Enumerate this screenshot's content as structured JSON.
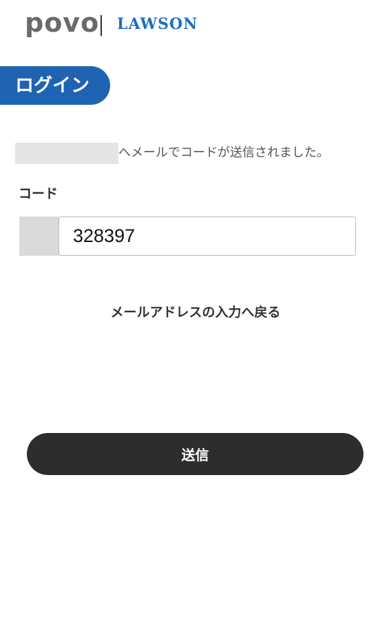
{
  "header": {
    "brand_primary": "povo",
    "brand_partner": "LAWSON"
  },
  "page": {
    "title": "ログイン"
  },
  "verification": {
    "sent_message": "へメールでコードが送信されました。"
  },
  "code_field": {
    "label": "コード",
    "value": "328397"
  },
  "links": {
    "back_to_email": "メールアドレスの入力へ戻る"
  },
  "actions": {
    "submit_label": "送信"
  },
  "colors": {
    "brand_blue": "#1f63b3",
    "lawson_blue": "#1e6fc4",
    "button_dark": "#2d2d2d",
    "mask_gray": "#e4e4e4"
  }
}
